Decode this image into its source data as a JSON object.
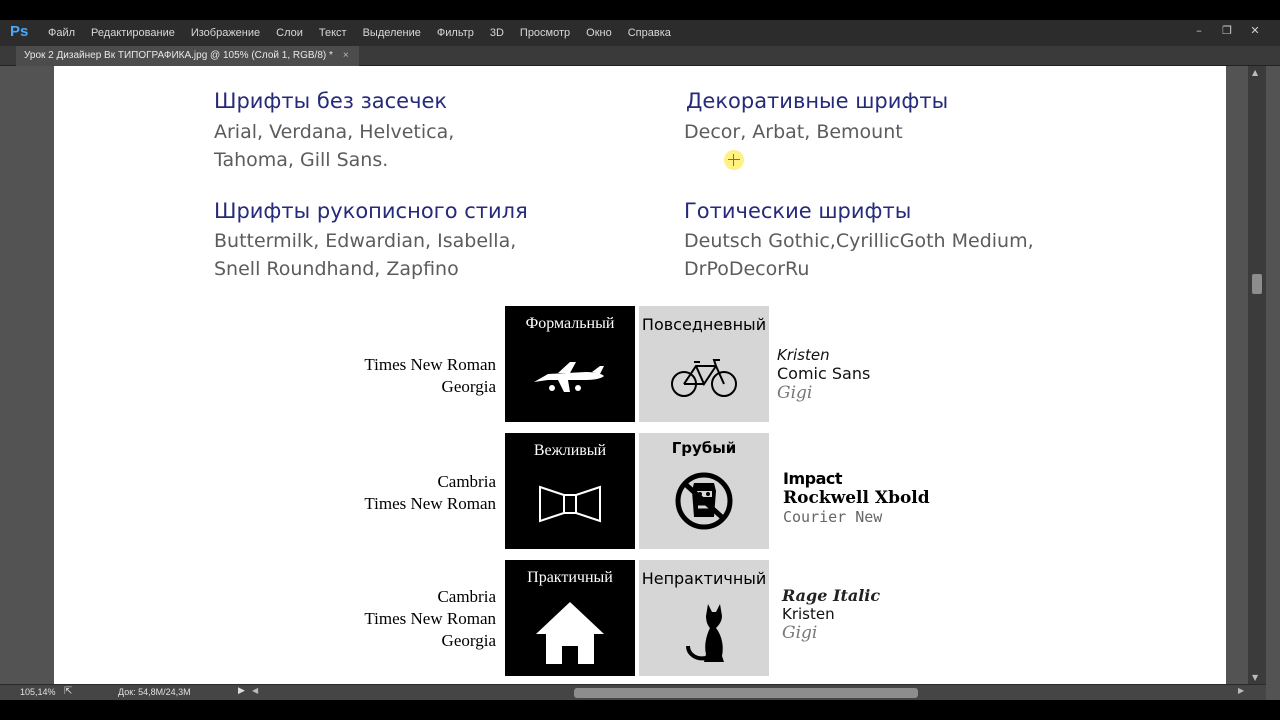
{
  "app": {
    "logo": "Ps"
  },
  "menu": [
    "Файл",
    "Редактирование",
    "Изображение",
    "Слои",
    "Текст",
    "Выделение",
    "Фильтр",
    "3D",
    "Просмотр",
    "Окно",
    "Справка"
  ],
  "window_controls": {
    "minimize": "–",
    "restore": "❐",
    "close": "✕"
  },
  "document_tab": {
    "title": "Урок 2 Дизайнер Вк ТИПОГРАФИКА.jpg @ 105% (Слой 1, RGB/8) *",
    "close": "×"
  },
  "status": {
    "zoom": "105,14%",
    "doc_size": "Док: 54,8M/24,3M"
  },
  "canvas": {
    "categories": [
      {
        "title": "Шрифты без засечек",
        "fonts": [
          "Arial, Verdana, Helvetica,",
          "Tahoma, Gill Sans."
        ]
      },
      {
        "title": "Декоративные шрифты",
        "fonts": [
          "Decor, Arbat, Bemount"
        ]
      },
      {
        "title": "Шрифты рукописного стиля",
        "fonts": [
          "Buttermilk, Edwardian, Isabella,",
          "Snell Roundhand, Zapfino"
        ]
      },
      {
        "title": "Готические шрифты",
        "fonts": [
          "Deutsch Gothic,CyrillicGoth Medium,",
          "DrPoDecorRu"
        ]
      }
    ],
    "rows": [
      {
        "left_fonts": [
          "Times New Roman",
          "Georgia"
        ],
        "black_tile": {
          "label": "Формальный",
          "icon": "airplane-icon"
        },
        "grey_tile": {
          "label": "Повседневный",
          "icon": "bicycle-icon"
        },
        "right_fonts": [
          "Kristen",
          "Comic Sans",
          "Gigi"
        ]
      },
      {
        "left_fonts": [
          "Cambria",
          "Times New Roman"
        ],
        "black_tile": {
          "label": "Вежливый",
          "icon": "bow-tie-icon"
        },
        "grey_tile": {
          "label": "Грубый",
          "icon": "rude-face-icon"
        },
        "right_fonts": [
          "Impact",
          "Rockwell Xbold",
          "Courier New"
        ]
      },
      {
        "left_fonts": [
          "Cambria",
          "Times New Roman",
          "Georgia"
        ],
        "black_tile": {
          "label": "Практичный",
          "icon": "house-icon"
        },
        "grey_tile": {
          "label": "Непрактичный",
          "icon": "cat-icon"
        },
        "right_fonts": [
          "Rage Italic",
          "Kristen",
          "Gigi"
        ]
      }
    ]
  }
}
